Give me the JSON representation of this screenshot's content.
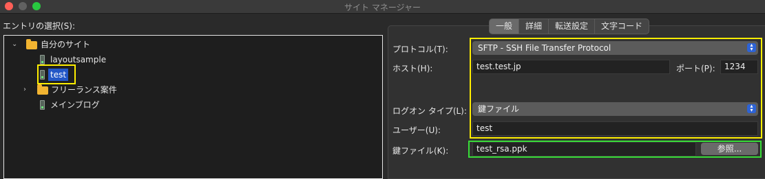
{
  "window": {
    "title": "サイト マネージャー"
  },
  "tree": {
    "label": "エントリの選択(S):",
    "root": {
      "label": "自分のサイト"
    },
    "sites": [
      {
        "label": "layoutsample"
      },
      {
        "label": "test"
      }
    ],
    "folder2": {
      "label": "フリーランス案件"
    },
    "site3": {
      "label": "メインブログ"
    }
  },
  "tabs": [
    "一般",
    "詳細",
    "転送設定",
    "文字コード"
  ],
  "form": {
    "protocol_label": "プロトコル(T):",
    "protocol_value": "SFTP - SSH File Transfer Protocol",
    "host_label": "ホスト(H):",
    "host_value": "test.test.jp",
    "port_label": "ポート(P):",
    "port_value": "1234",
    "logon_label": "ログオン タイプ(L):",
    "logon_value": "鍵ファイル",
    "user_label": "ユーザー(U):",
    "user_value": "test",
    "keyfile_label": "鍵ファイル(K):",
    "keyfile_value": "test_rsa.ppk",
    "browse_label": "参照..."
  },
  "colors": {
    "highlight_yellow": "#ffee00",
    "highlight_green": "#38dd38",
    "selection": "#2357c7",
    "select_arrow": "#2d63d6"
  }
}
